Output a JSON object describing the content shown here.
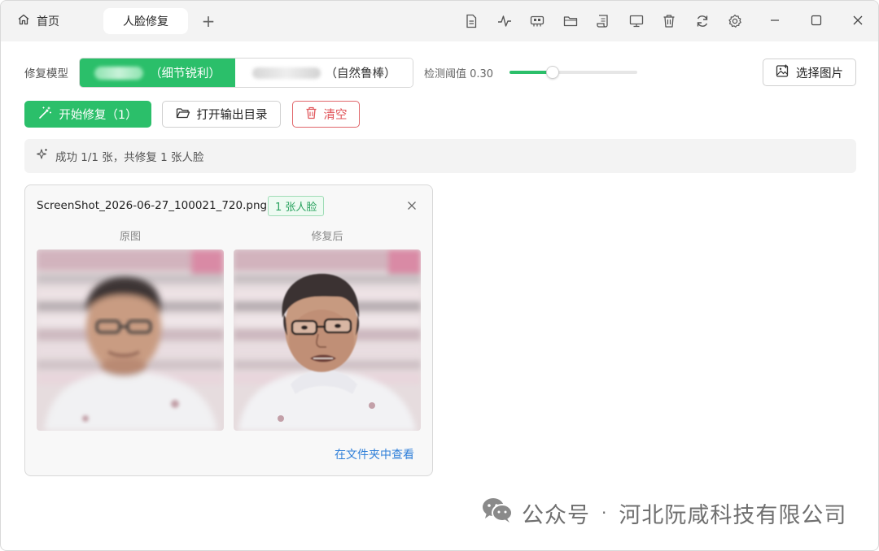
{
  "titlebar": {
    "home_tab_label": "首页",
    "active_tab_label": "人脸修复",
    "add_tab_symbol": "+",
    "toolbar_icons": [
      "document-icon",
      "pulse-icon",
      "chip-icon",
      "folder-icon",
      "scroll-icon",
      "monitor-icon",
      "trash-icon",
      "refresh-icon",
      "settings-icon"
    ]
  },
  "model": {
    "label": "修复模型",
    "option_a_suffix": "（细节锐利）",
    "option_b_suffix": "（自然鲁棒）",
    "selected": "option_a"
  },
  "threshold": {
    "label": "检测阈值 0.30",
    "value": 0.3,
    "slider_fraction": 0.34
  },
  "select_button": {
    "label": "选择图片"
  },
  "actions": {
    "start_label": "开始修复（1）",
    "open_output_label": "打开输出目录",
    "clear_label": "清空"
  },
  "status": {
    "text": "成功 1/1 张，共修复 1 张人脸"
  },
  "result_card": {
    "filename": "ScreenShot_2026-06-27_100021_720.png",
    "badge": "1 张人脸",
    "original_label": "原图",
    "restored_label": "修复后",
    "view_in_folder_label": "在文件夹中查看"
  },
  "watermark": {
    "channel": "公众号",
    "separator": "·",
    "company": "河北阮咸科技有限公司"
  },
  "colors": {
    "accent": "#2bbf6a",
    "danger": "#e0555a",
    "link": "#2f7fd9",
    "titlebar_bg": "#f3f3f3"
  }
}
